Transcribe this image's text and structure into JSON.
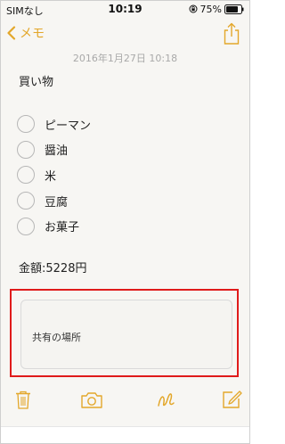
{
  "status_bar": {
    "carrier": "SIMなし",
    "time": "10:19",
    "battery": "75%"
  },
  "nav": {
    "back_label": "メモ",
    "accent_color": "#e3a72a"
  },
  "note": {
    "date": "2016年1月27日 10:18",
    "title": "買い物",
    "checklist": [
      {
        "label": "ピーマン",
        "checked": false
      },
      {
        "label": "醤油",
        "checked": false
      },
      {
        "label": "米",
        "checked": false
      },
      {
        "label": "豆腐",
        "checked": false
      },
      {
        "label": "お菓子",
        "checked": false
      }
    ],
    "total": "金額:5228円"
  },
  "shared_card": {
    "label": "共有の場所"
  },
  "toolbar": {
    "icons": [
      "trash-icon",
      "camera-icon",
      "sketch-icon",
      "compose-icon"
    ]
  }
}
